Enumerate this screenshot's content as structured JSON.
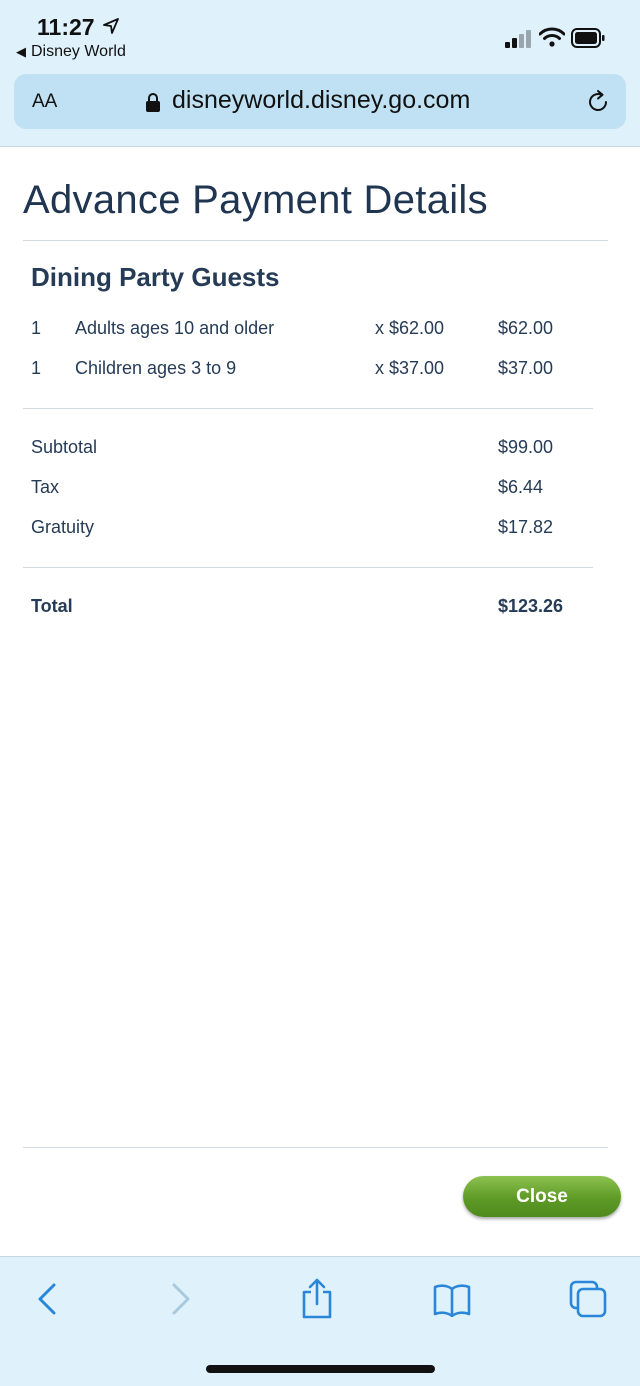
{
  "status_bar": {
    "time": "11:27",
    "back_app": "Disney World"
  },
  "browser": {
    "text_size_button": "AA",
    "url": "disneyworld.disney.go.com"
  },
  "page": {
    "title": "Advance Payment Details",
    "section_title": "Dining Party Guests",
    "guests": [
      {
        "qty": "1",
        "description": "Adults ages 10 and older",
        "unit_price": "x $62.00",
        "amount": "$62.00"
      },
      {
        "qty": "1",
        "description": "Children ages 3 to 9",
        "unit_price": "x $37.00",
        "amount": "$37.00"
      }
    ],
    "summary": [
      {
        "label": "Subtotal",
        "amount": "$99.00"
      },
      {
        "label": "Tax",
        "amount": "$6.44"
      },
      {
        "label": "Gratuity",
        "amount": "$17.82"
      }
    ],
    "total": {
      "label": "Total",
      "amount": "$123.26"
    },
    "close_label": "Close"
  },
  "colors": {
    "chrome_bg": "#dff2fb",
    "url_bar_bg": "#bfe1f3",
    "text": "#253b56",
    "button_green": "#5e9a26"
  },
  "icons": {
    "location": "location-arrow-icon",
    "signal": "cellular-signal-icon",
    "wifi": "wifi-icon",
    "battery": "battery-icon",
    "lock": "lock-icon",
    "reload": "reload-icon",
    "back": "chevron-left-icon",
    "forward": "chevron-right-icon",
    "share": "share-icon",
    "bookmarks": "book-icon",
    "tabs": "tabs-icon"
  }
}
